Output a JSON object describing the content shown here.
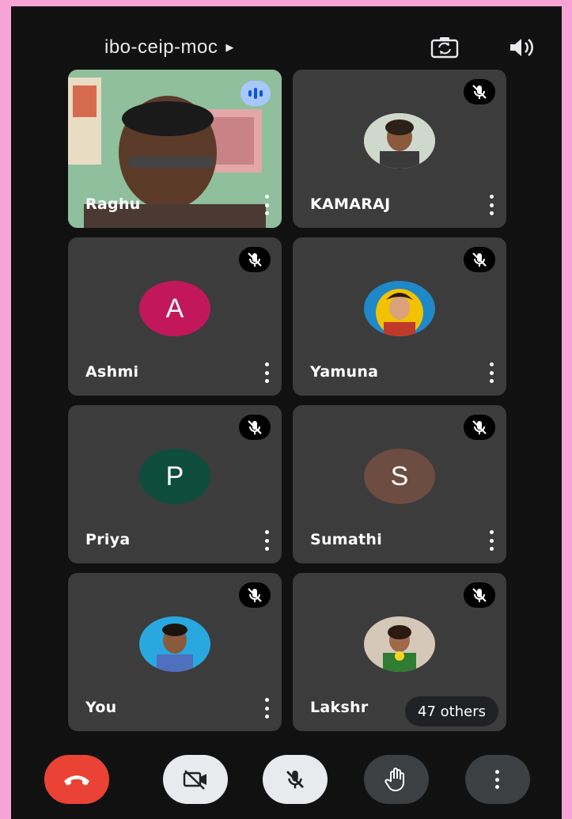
{
  "meeting": {
    "code": "ibo-ceip-moc"
  },
  "participants": [
    {
      "name": "Raghu",
      "muted": false,
      "avatar_type": "video"
    },
    {
      "name": "KAMARAJ",
      "muted": true,
      "avatar_type": "photo"
    },
    {
      "name": "Ashmi",
      "muted": true,
      "avatar_type": "letter",
      "initial": "A",
      "color": "#c2185b"
    },
    {
      "name": "Yamuna",
      "muted": true,
      "avatar_type": "photo"
    },
    {
      "name": "Priya",
      "muted": true,
      "avatar_type": "letter",
      "initial": "P",
      "color": "#0e4d3c"
    },
    {
      "name": "Sumathi",
      "muted": true,
      "avatar_type": "letter",
      "initial": "S",
      "color": "#6d4c41"
    },
    {
      "name": "You",
      "muted": true,
      "avatar_type": "photo"
    },
    {
      "name": "Lakshr",
      "muted": true,
      "avatar_type": "photo"
    }
  ],
  "others_badge": "47 others",
  "icons": {
    "top": [
      "switch-camera-icon",
      "speaker-icon"
    ],
    "controls": [
      "end-call-icon",
      "camera-off-icon",
      "mic-off-icon",
      "raise-hand-icon",
      "more-options-icon"
    ]
  },
  "colors": {
    "end_call": "#ea4335",
    "control_light": "#e8eaed",
    "control_dark": "#3c4043",
    "tile_bg": "#3c3c3c"
  }
}
